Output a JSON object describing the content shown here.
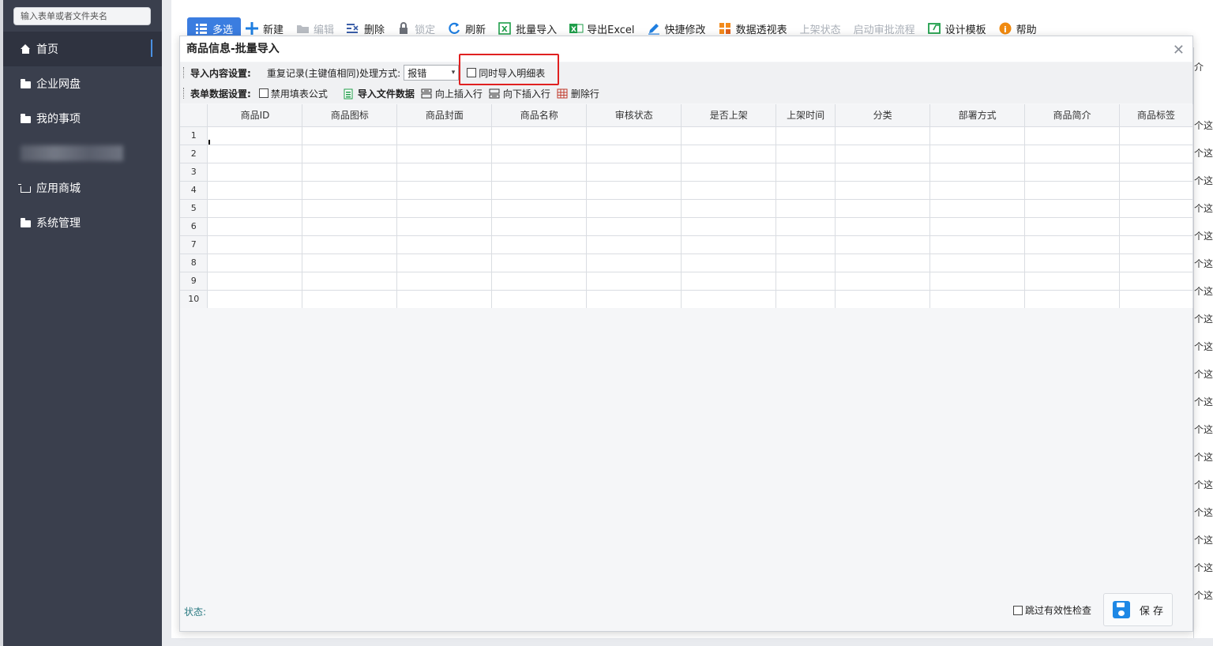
{
  "sidebar": {
    "search_placeholder": "输入表单或者文件夹名",
    "items": [
      {
        "label": "首页"
      },
      {
        "label": "企业网盘"
      },
      {
        "label": "我的事项"
      },
      {
        "label": "应用商城"
      },
      {
        "label": "系统管理"
      }
    ]
  },
  "toolbar": {
    "multi_select": "多选",
    "new": "新建",
    "edit": "编辑",
    "delete": "删除",
    "lock": "锁定",
    "refresh": "刷新",
    "batch_import": "批量导入",
    "export_excel": "导出Excel",
    "quick_edit": "快捷修改",
    "pivot": "数据透视表",
    "shelf_status": "上架状态",
    "start_approval": "启动审批流程",
    "design_template": "设计模板",
    "help": "帮助"
  },
  "dialog": {
    "title": "商品信息-批量导入",
    "import_settings_label": "导入内容设置:",
    "duplicate_label": "重复记录(主键值相同)处理方式:",
    "duplicate_value": "报错",
    "import_detail_label": "同时导入明细表",
    "form_settings_label": "表单数据设置:",
    "disable_formula_label": "禁用填表公式",
    "import_file_label": "导入文件数据",
    "insert_above_label": "向上插入行",
    "insert_below_label": "向下插入行",
    "delete_row_label": "删除行",
    "columns": [
      "商品ID",
      "商品图标",
      "商品封面",
      "商品名称",
      "审核状态",
      "是否上架",
      "上架时间",
      "分类",
      "部署方式",
      "商品简介",
      "商品标签"
    ],
    "rows": [
      "1",
      "2",
      "3",
      "4",
      "5",
      "6",
      "7",
      "8",
      "9",
      "10"
    ],
    "status_label": "状态:",
    "skip_check_label": "跳过有效性检查",
    "save_label": "保 存"
  },
  "behind": {
    "header_text": "介",
    "cell_text": "个这"
  },
  "colors": {
    "sidebar_bg": "#3a3f4d",
    "primary": "#3b7de0",
    "highlight": "#e02020"
  }
}
